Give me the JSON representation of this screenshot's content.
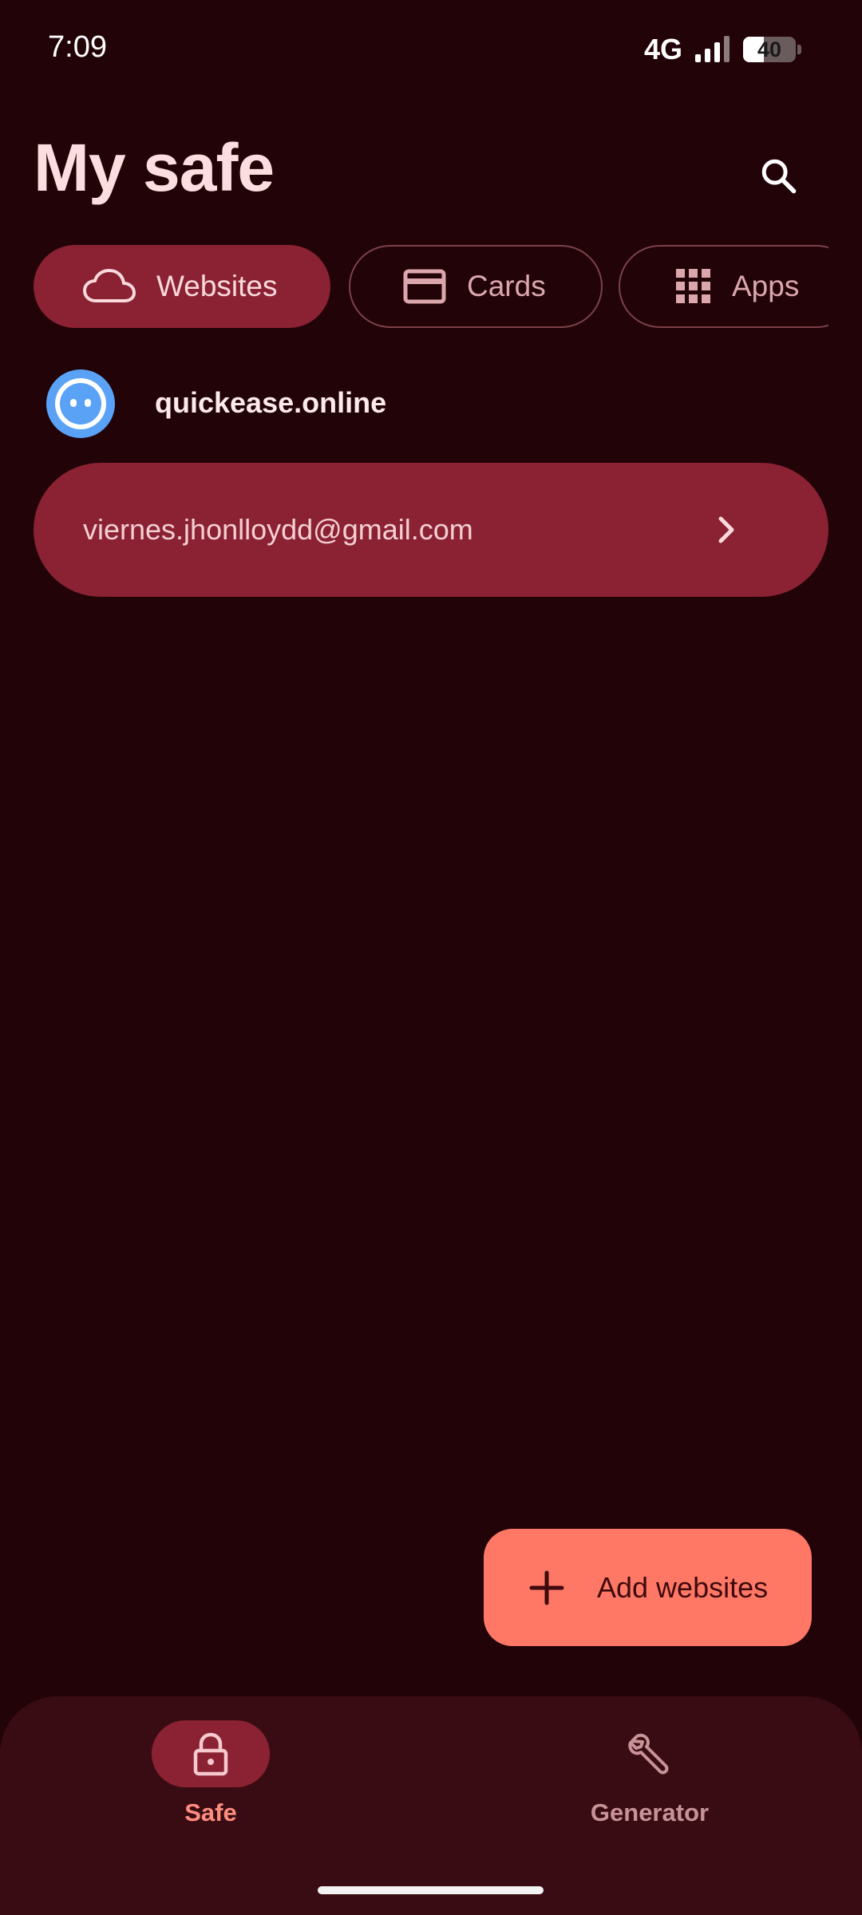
{
  "status_bar": {
    "time": "7:09",
    "network": "4G",
    "battery_level": "40",
    "battery_fraction": 0.4
  },
  "header": {
    "title": "My safe"
  },
  "tabs": [
    {
      "label": "Websites",
      "icon": "cloud-icon",
      "selected": true
    },
    {
      "label": "Cards",
      "icon": "card-icon",
      "selected": false
    },
    {
      "label": "Apps",
      "icon": "apps-grid-icon",
      "selected": false
    }
  ],
  "site": {
    "name": "quickease.online",
    "logo_icon": "quickease-logo-icon",
    "logo_color": "#5aa2f6"
  },
  "credential": {
    "email": "viernes.jhonlloydd@gmail.com"
  },
  "fab": {
    "label": "Add websites",
    "icon": "plus-icon"
  },
  "bottom_nav": {
    "items": [
      {
        "label": "Safe",
        "icon": "lock-icon",
        "active": true
      },
      {
        "label": "Generator",
        "icon": "wrench-icon",
        "active": false
      }
    ]
  },
  "colors": {
    "background": "#220308",
    "accent": "#8a2233",
    "fab": "#ff7866",
    "nav_bg": "#390c13"
  }
}
